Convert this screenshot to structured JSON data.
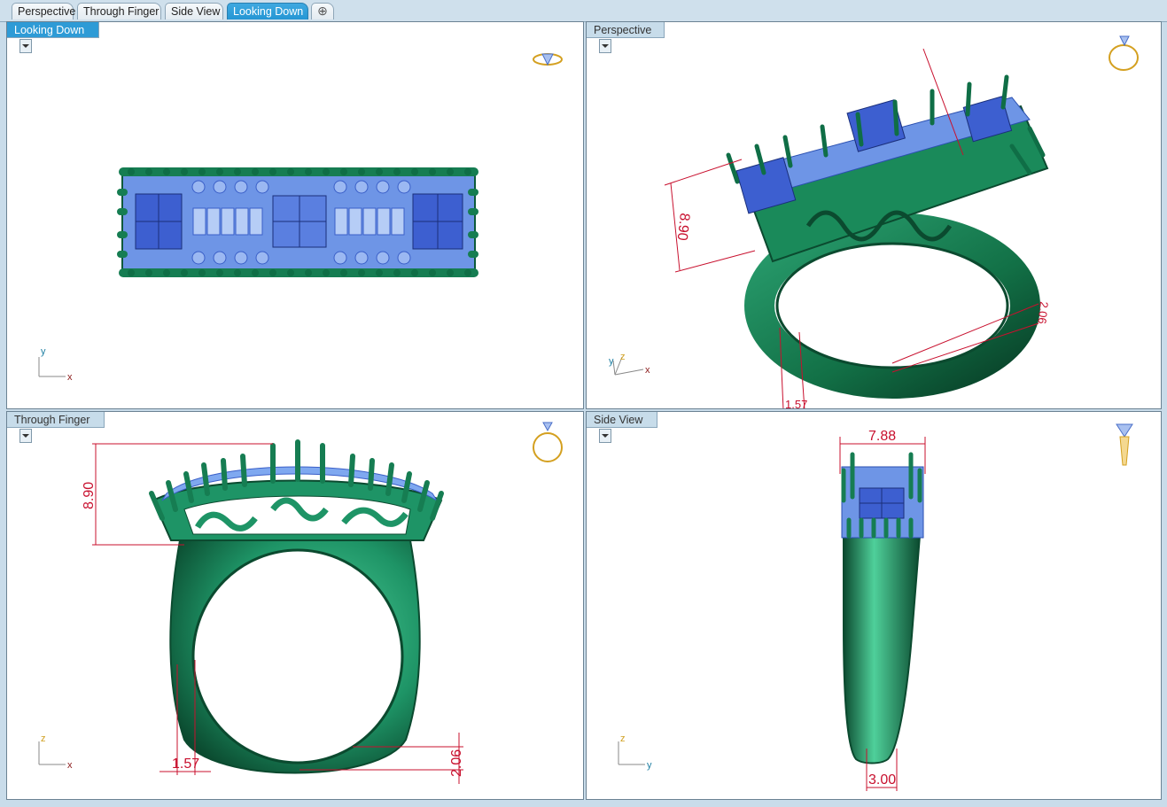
{
  "tabs": [
    {
      "label": "Perspective",
      "active": false
    },
    {
      "label": "Through Finger",
      "active": false
    },
    {
      "label": "Side View",
      "active": false
    },
    {
      "label": "Looking Down",
      "active": true
    }
  ],
  "add_tab_icon": "plus-icon",
  "viewports": {
    "looking_down": {
      "title": "Looking Down",
      "axes": [
        "y",
        "x"
      ]
    },
    "perspective": {
      "title": "Perspective",
      "axes": [
        "y",
        "z",
        "x"
      ],
      "dimensions": [
        "8.90",
        "2.06",
        "1.57"
      ]
    },
    "through_finger": {
      "title": "Through Finger",
      "axes": [
        "z",
        "x"
      ],
      "dimensions": [
        "8.90",
        "1.57",
        "2.06"
      ]
    },
    "side_view": {
      "title": "Side View",
      "axes": [
        "z",
        "y"
      ],
      "dimensions": [
        "7.88",
        "3.00"
      ]
    }
  },
  "colors": {
    "metal": "#1e8a5e",
    "metal_dark": "#0d4d33",
    "stone": "#7fa8f0",
    "stone_dark": "#3a5fc8",
    "dimension": "#c8102e",
    "active_tab": "#2e9bd6",
    "axis_x": "#8b1a1a",
    "axis_y": "#1f7fa3",
    "axis_z": "#d0a020"
  }
}
